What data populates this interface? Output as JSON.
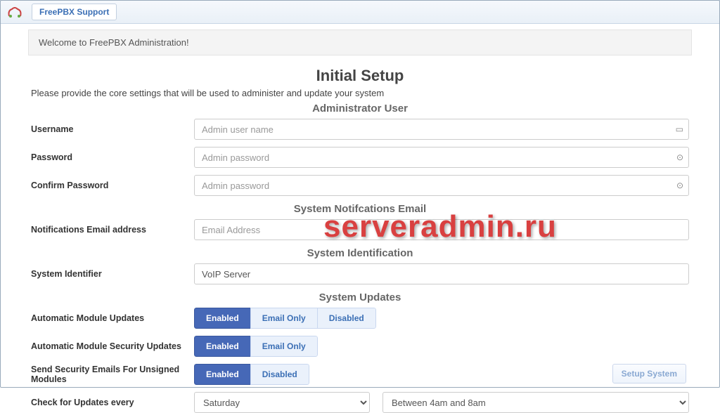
{
  "topbar": {
    "tab_label": "FreePBX Support"
  },
  "welcome": "Welcome to FreePBX Administration!",
  "title": "Initial Setup",
  "intro": "Please provide the core settings that will be used to administer and update your system",
  "sections": {
    "admin_user": "Administrator User",
    "notifications": "System Notifcations Email",
    "identification": "System Identification",
    "updates": "System Updates"
  },
  "labels": {
    "username": "Username",
    "password": "Password",
    "confirm": "Confirm Password",
    "notif_email": "Notifications Email address",
    "system_id": "System Identifier",
    "auto_updates": "Automatic Module Updates",
    "auto_sec_updates": "Automatic Module Security Updates",
    "send_unsigned": "Send Security Emails For Unsigned Modules",
    "check_every": "Check for Updates every"
  },
  "placeholders": {
    "username": "Admin user name",
    "password": "Admin password",
    "confirm": "Admin password",
    "notif_email": "Email Address"
  },
  "values": {
    "system_id": "VoIP Server",
    "check_day": "Saturday",
    "check_time": "Between 4am and 8am"
  },
  "toggles": {
    "enabled": "Enabled",
    "email_only": "Email Only",
    "disabled": "Disabled"
  },
  "setup_button": "Setup System",
  "watermark": "serveradmin.ru"
}
